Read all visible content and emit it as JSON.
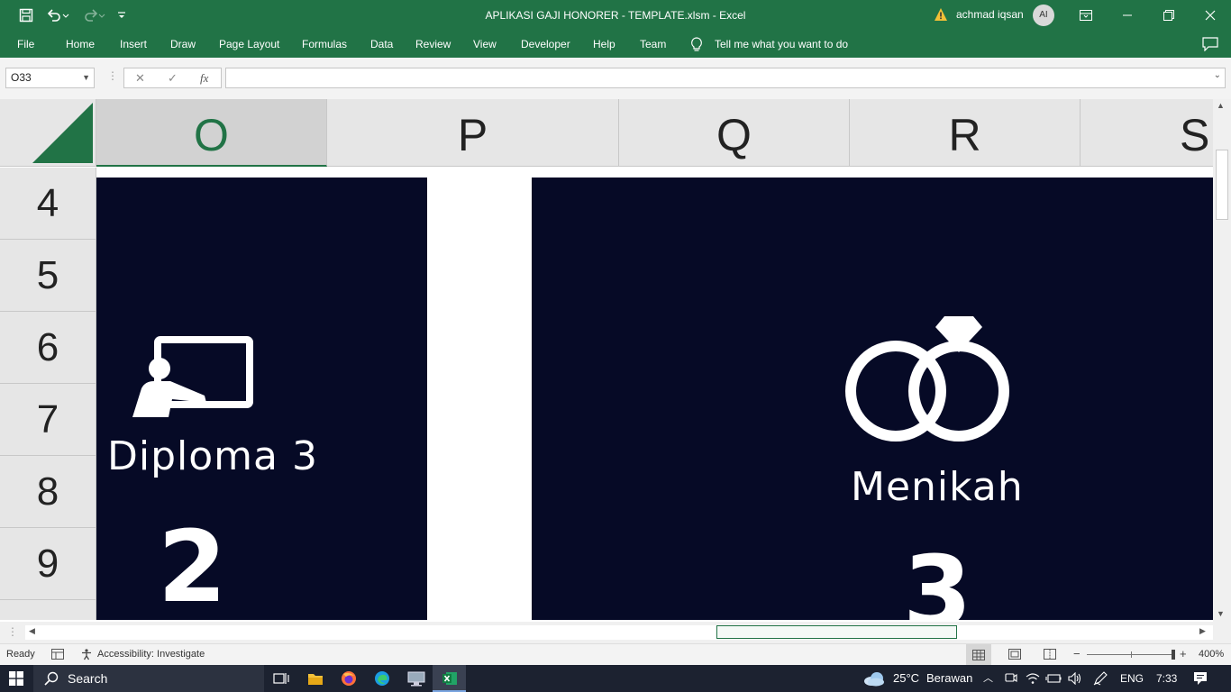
{
  "title_bar": {
    "title": "APLIKASI GAJI HONORER - TEMPLATE.xlsm  -  Excel",
    "user_name": "achmad iqsan",
    "avatar_initials": "AI"
  },
  "menu": {
    "tabs": [
      "File",
      "Home",
      "Insert",
      "Draw",
      "Page Layout",
      "Formulas",
      "Data",
      "Review",
      "View",
      "Developer",
      "Help",
      "Team"
    ],
    "tell_me": "Tell me what you want to do"
  },
  "formula_bar": {
    "name_box": "O33",
    "fx_label": "fx",
    "formula": ""
  },
  "sheet": {
    "columns": [
      {
        "label": "O",
        "selected": true
      },
      {
        "label": "P",
        "selected": false
      },
      {
        "label": "Q",
        "selected": false
      },
      {
        "label": "R",
        "selected": false
      },
      {
        "label": "S",
        "selected": false
      }
    ],
    "rows": [
      "4",
      "5",
      "6",
      "7",
      "8",
      "9"
    ],
    "cards": [
      {
        "label": "Diploma 3",
        "value": "2",
        "icon": "teacher-board-icon"
      },
      {
        "label": "Menikah",
        "value": "3",
        "icon": "wedding-rings-icon"
      }
    ]
  },
  "status_bar": {
    "ready": "Ready",
    "accessibility": "Accessibility: Investigate",
    "zoom": "400%"
  },
  "taskbar": {
    "search_label": "Search",
    "weather_temp": "25°C",
    "weather_desc": "Berawan",
    "language": "ENG",
    "time": "7:33"
  },
  "colors": {
    "excel_green": "#217346",
    "card_background": "#060a26",
    "taskbar": "#1c2230"
  }
}
